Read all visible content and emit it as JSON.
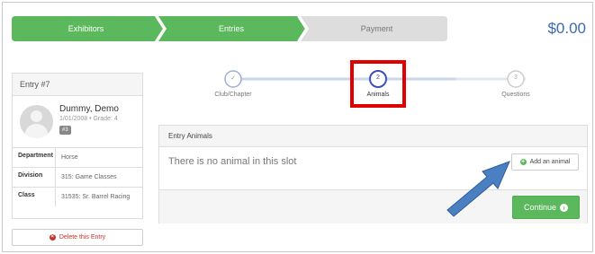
{
  "steps": {
    "items": [
      {
        "label": "Exhibitors"
      },
      {
        "label": "Entries"
      },
      {
        "label": "Payment"
      }
    ],
    "total": "$0.00"
  },
  "entry": {
    "title": "Entry #7",
    "exhibitor_name": "Dummy, Demo",
    "exhibitor_meta": "1/01/2008 • Grade: 4",
    "exhibitor_badge": "#3",
    "rows": [
      {
        "key": "Department",
        "value": "Horse"
      },
      {
        "key": "Division",
        "value": "315: Game Classes"
      },
      {
        "key": "Class",
        "value": "31535: Sr. Barrel Racing"
      }
    ],
    "delete_label": "Delete this Entry"
  },
  "wizard": {
    "steps": [
      {
        "number": "✓",
        "label": "Club/Chapter"
      },
      {
        "number": "2",
        "label": "Animals"
      },
      {
        "number": "3",
        "label": "Questions"
      }
    ]
  },
  "animals_panel": {
    "title": "Entry Animals",
    "empty_message": "There is no animal in this slot",
    "add_label": "Add an animal",
    "continue_label": "Continue"
  },
  "colors": {
    "step_done": "#5cb85c",
    "step_todo": "#dddddd",
    "total_text": "#3a6bb1",
    "highlight": "#e00000",
    "pointer_arrow": "#4a7fc1",
    "wizard_active": "#3f51b5"
  }
}
